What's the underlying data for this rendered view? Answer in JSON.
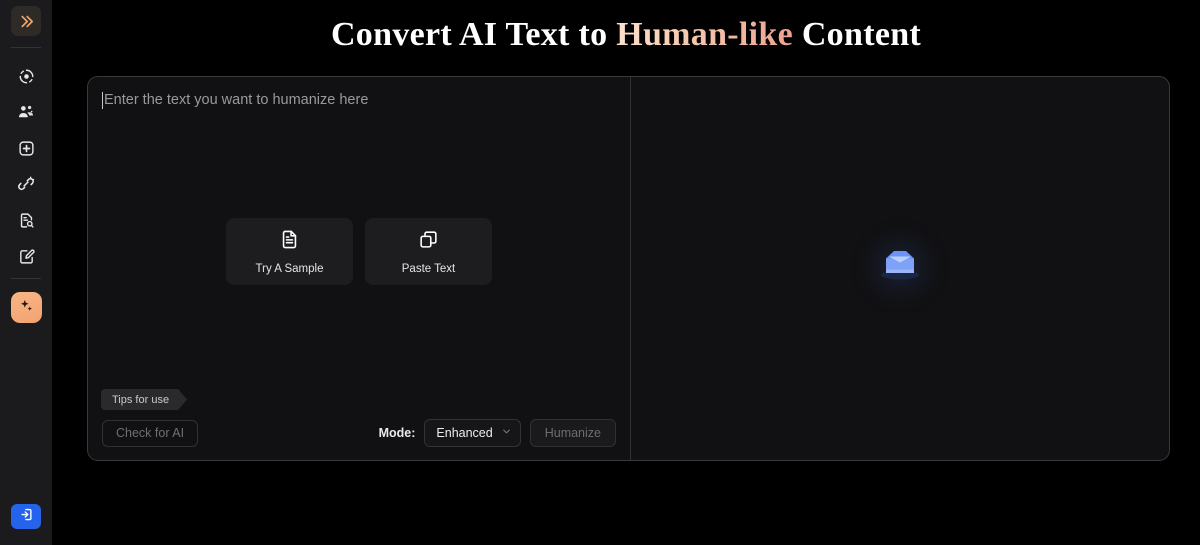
{
  "header": {
    "title_part1": "Convert AI Text to ",
    "title_highlight": "Human-like",
    "title_part2": " Content",
    "highlight_color_start": "#fae2cd",
    "highlight_color_end": "#eda291"
  },
  "sidebar": {
    "collapse_button": {
      "icon": "chevrons-right-icon",
      "color": "#f0a86e"
    },
    "items": [
      {
        "icon": "detector-target-icon",
        "name": "ai-detector"
      },
      {
        "icon": "users-group-icon",
        "name": "team"
      },
      {
        "icon": "shield-plus-icon",
        "name": "plagiarism-shield"
      },
      {
        "icon": "link-scan-icon",
        "name": "link-scan"
      },
      {
        "icon": "document-search-icon",
        "name": "document-search"
      },
      {
        "icon": "note-edit-icon",
        "name": "note-edit"
      }
    ],
    "active_item": {
      "icon": "sparkles-icon",
      "name": "humanizer",
      "background": "#f5ab79"
    },
    "login_button": {
      "icon": "login-arrow-icon",
      "background": "#2563eb"
    }
  },
  "editor": {
    "input": {
      "placeholder": "Enter the text you want to humanize here",
      "value": ""
    },
    "quick_actions": [
      {
        "label": "Try A Sample",
        "icon": "document-lines-icon"
      },
      {
        "label": "Paste Text",
        "icon": "copy-stack-icon"
      }
    ],
    "toolbar": {
      "check_for_ai_label": "Check for AI",
      "check_for_ai_enabled": false,
      "mode_label": "Mode:",
      "mode_value": "Enhanced",
      "mode_chevron": "chevron-down-icon",
      "humanize_label": "Humanize",
      "humanize_enabled": false
    },
    "output": {
      "icon": "envelope-icon",
      "icon_color": "#6a94f5"
    }
  },
  "tips": {
    "label": "Tips for use"
  }
}
